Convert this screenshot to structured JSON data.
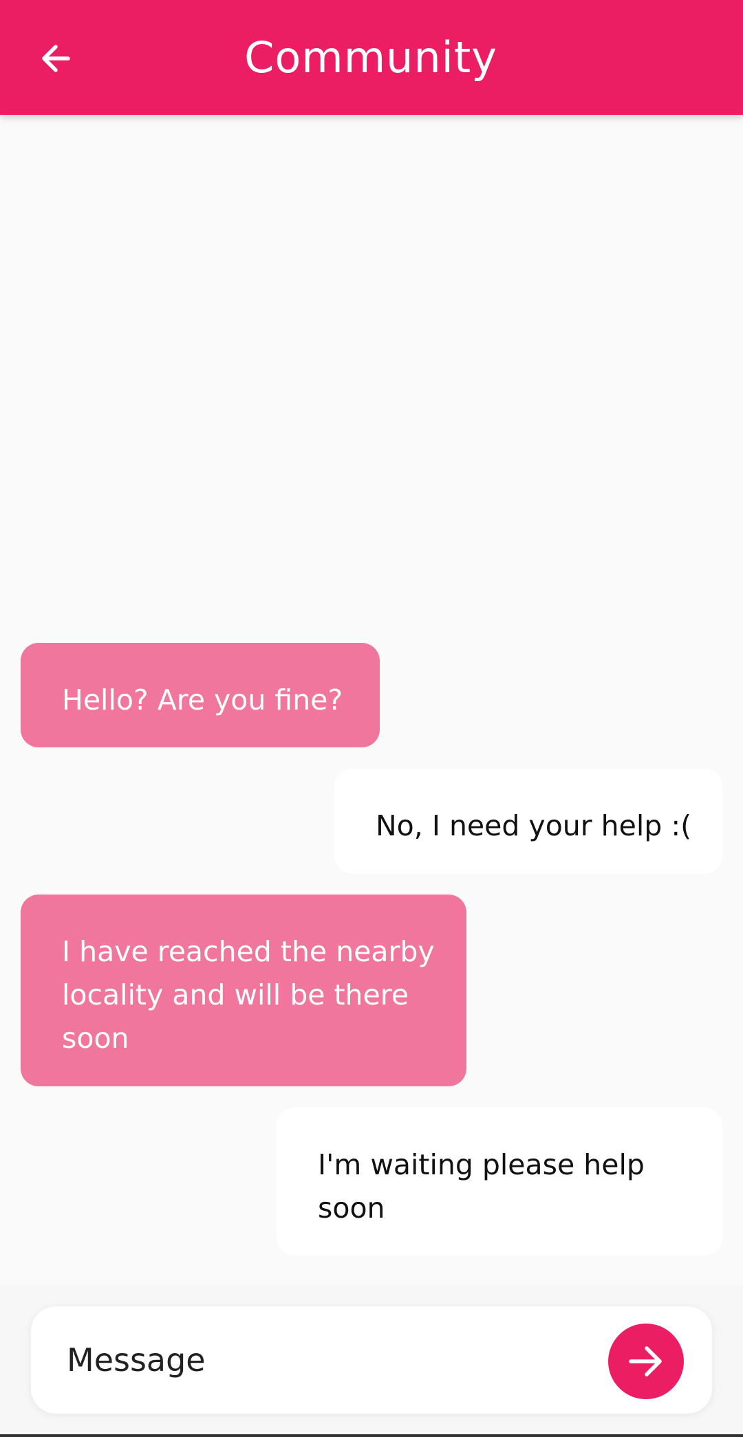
{
  "app_bar": {
    "title": "Community",
    "back_icon": "arrow-left-icon",
    "background": "#ec1e63"
  },
  "messages": [
    {
      "direction": "incoming",
      "text": "Hello? Are you fine?"
    },
    {
      "direction": "outgoing",
      "text": "No, I need your help :("
    },
    {
      "direction": "incoming",
      "text": "I have reached the nearby locality and will be there soon"
    },
    {
      "direction": "outgoing",
      "text": "I'm waiting please help soon"
    }
  ],
  "composer": {
    "placeholder": "Message",
    "value": "",
    "send_icon": "arrow-right-icon"
  },
  "colors": {
    "accent": "#ec1e63",
    "incoming_bubble": "#f1769d",
    "outgoing_bubble": "#ffffff",
    "background": "#fafafa"
  }
}
